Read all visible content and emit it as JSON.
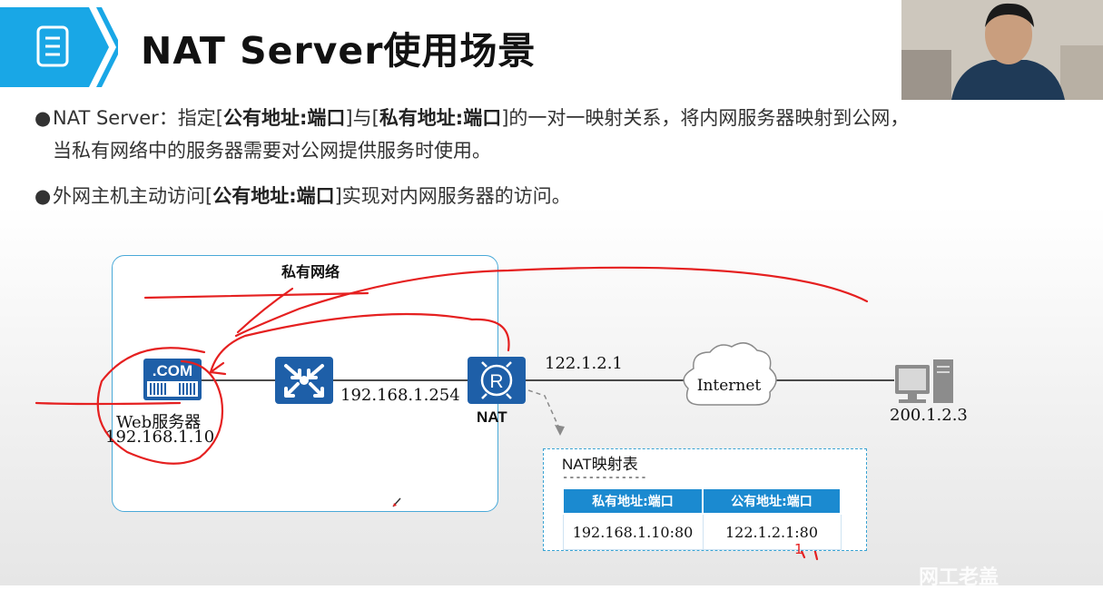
{
  "header": {
    "title": "NAT Server使用场景",
    "icon": "document-icon"
  },
  "bullets": [
    {
      "term": "NAT Server",
      "sep": "：指定[",
      "bold1": "公有地址:端口",
      "mid": "]与[",
      "bold2": "私有地址:端口",
      "tail": "]的一对一映射关系，将内网服务器映射到公网，",
      "line2": "当私有网络中的服务器需要对公网提供服务时使用。"
    },
    {
      "pre": "外网主机主动访问[",
      "bold": "公有地址:端口",
      "tail": "]实现对内网服务器的访问。"
    }
  ],
  "diagram": {
    "private_network_label": "私有网络",
    "server": {
      "icon_text": ".COM",
      "name": "Web服务器",
      "ip": "192.168.1.10"
    },
    "switch": {
      "ip": "192.168.1.254"
    },
    "router": {
      "label": "NAT",
      "public_ip": "122.1.2.1"
    },
    "cloud": {
      "label": "Internet"
    },
    "host": {
      "ip": "200.1.2.3"
    },
    "nat_table": {
      "title": "NAT映射表",
      "dashes": "-------------",
      "headers": [
        "私有地址:端口",
        "公有地址:端口"
      ],
      "rows": [
        [
          "192.168.1.10:80",
          "122.1.2.1:80"
        ]
      ]
    }
  },
  "annotation_text": "1",
  "watermark": "网工老盖"
}
